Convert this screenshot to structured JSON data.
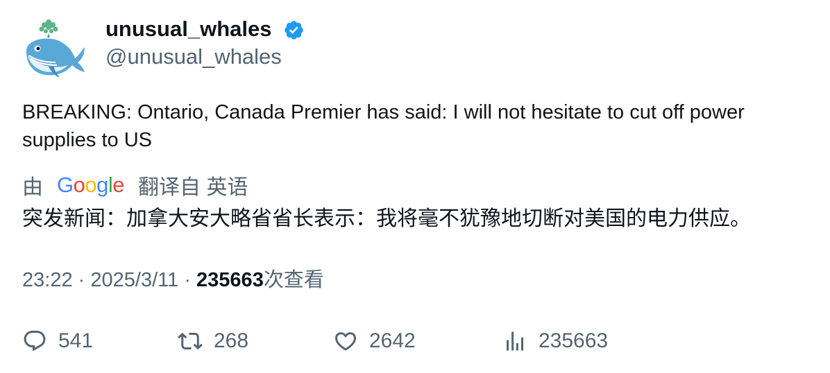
{
  "author": {
    "display_name": "unusual_whales",
    "handle": "@unusual_whales",
    "verified": true,
    "avatar_icon": "whale-logo-icon"
  },
  "tweet": {
    "text": "BREAKING: Ontario, Canada Premier has said: I will not hesitate to cut off power supplies to US"
  },
  "translation": {
    "prefix": "由",
    "provider_letters": [
      "G",
      "o",
      "o",
      "g",
      "l",
      "e"
    ],
    "suffix": "翻译自 英语",
    "text": "突发新闻：加拿大安大略省省长表示：我将毫不犹豫地切断对美国的电力供应。"
  },
  "meta": {
    "time": "23:22",
    "separator": "·",
    "date": "2025/3/11",
    "views_count": "235663",
    "views_label": "次查看"
  },
  "actions": {
    "reply_count": "541",
    "retweet_count": "268",
    "like_count": "2642",
    "views_count": "235663"
  },
  "colors": {
    "text_primary": "#0f1419",
    "text_secondary": "#536471",
    "verified_blue": "#1d9bf0"
  }
}
